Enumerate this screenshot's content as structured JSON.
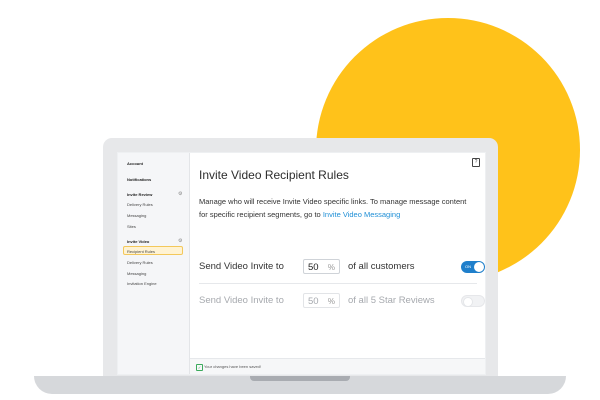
{
  "sidebar": {
    "account": "Account",
    "notifications": "Notifications",
    "invite_review": {
      "heading": "Invite Review",
      "items": [
        "Delivery Rules",
        "Messaging",
        "Sites"
      ]
    },
    "invite_video": {
      "heading": "Invite Video",
      "items": [
        "Recipient Rules",
        "Delivery Rules",
        "Messaging",
        "Invitation Engine"
      ],
      "active": "Recipient Rules"
    }
  },
  "main": {
    "title": "Invite Video Recipient Rules",
    "description": "Manage who will receive Invite Video specific links. To manage message content for specific recipient segments, go to",
    "description_link": "Invite Video Messaging",
    "rules": [
      {
        "label": "Send Video Invite to",
        "value": "50",
        "unit": "%",
        "tail": "of all customers",
        "toggle": "ON",
        "enabled": true
      },
      {
        "label": "Send Video Invite to",
        "value": "50",
        "unit": "%",
        "tail": "of all 5 Star Reviews",
        "toggle": "",
        "enabled": false
      }
    ],
    "footer": "Your changes have been saved!"
  },
  "colors": {
    "accent_circle": "#FFC21A",
    "toggle_on": "#1F7FCB",
    "link": "#1F8FD6",
    "active_item_bg": "#FFF3D3"
  }
}
